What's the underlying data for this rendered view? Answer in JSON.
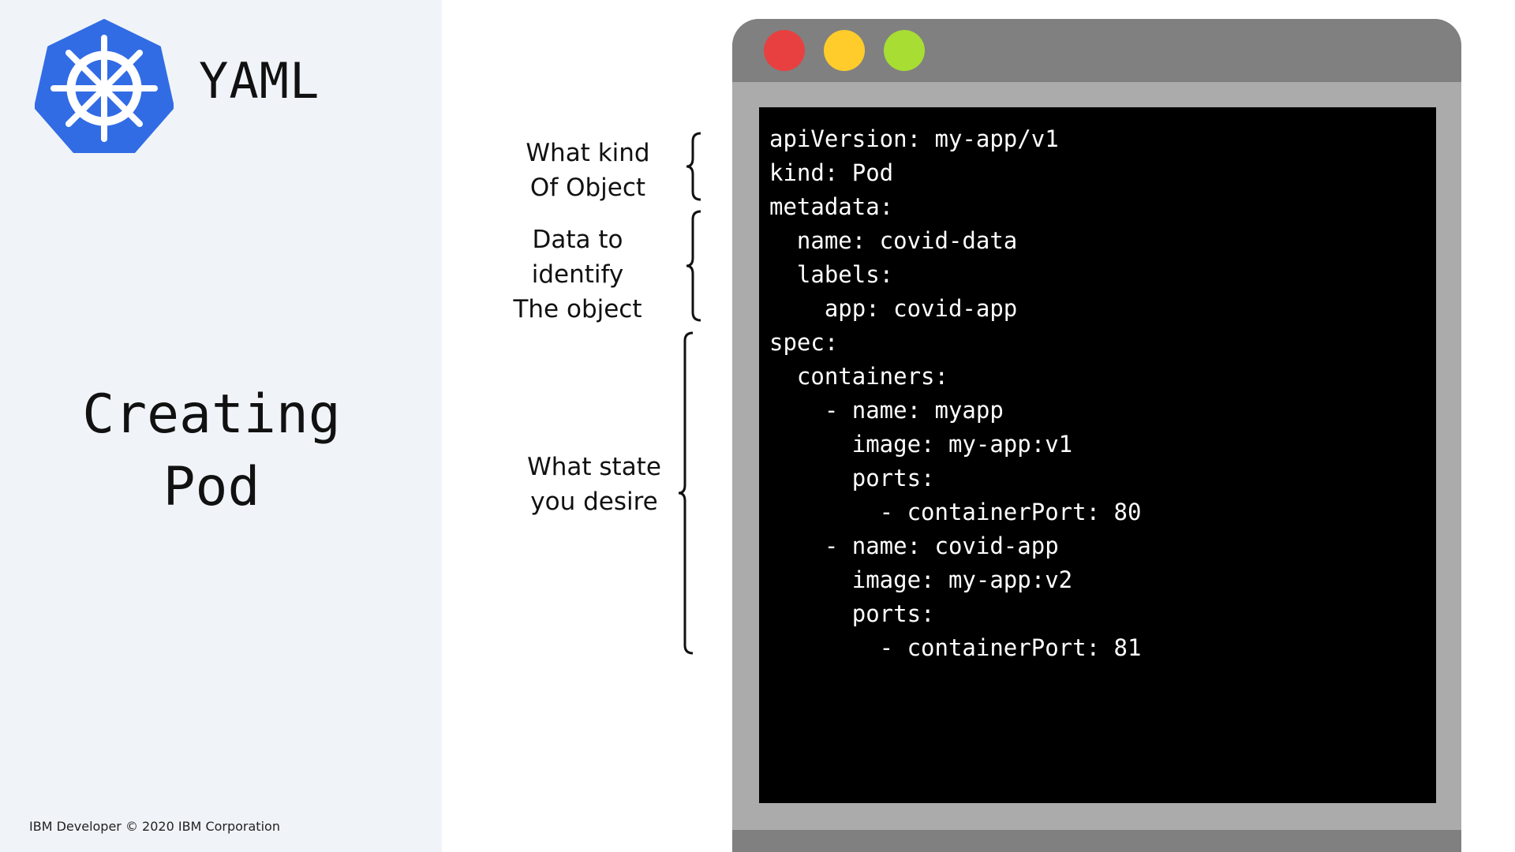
{
  "header": {
    "logo_icon": "kubernetes-helm-wheel-icon",
    "title": "YAML"
  },
  "slide": {
    "title_lines": [
      "Creating",
      "Pod"
    ]
  },
  "footer": {
    "text": "IBM Developer © 2020 IBM Corporation"
  },
  "annotations": [
    {
      "lines": [
        "What kind",
        "Of Object"
      ]
    },
    {
      "lines": [
        "Data to identify",
        "The object"
      ]
    },
    {
      "lines": [
        "What state",
        "you desire"
      ]
    }
  ],
  "window": {
    "buttons": [
      "close",
      "minimize",
      "maximize"
    ],
    "colors": {
      "close": "#e84040",
      "minimize": "#ffcc2b",
      "maximize": "#a8dd34"
    }
  },
  "code": {
    "lines": [
      "apiVersion: my-app/v1",
      "kind: Pod",
      "metadata:",
      "  name: covid-data",
      "  labels:",
      "    app: covid-app",
      "spec:",
      "  containers:",
      "    - name: myapp",
      "      image: my-app:v1",
      "      ports:",
      "        - containerPort: 80",
      "    - name: covid-app",
      "      image: my-app:v2",
      "      ports:",
      "        - containerPort: 81"
    ]
  },
  "colors": {
    "left_panel_bg": "#f0f4f8",
    "logo_blue": "#326ce5",
    "terminal_bg": "#000000",
    "window_frame": "#ababab",
    "titlebar": "#808080"
  }
}
